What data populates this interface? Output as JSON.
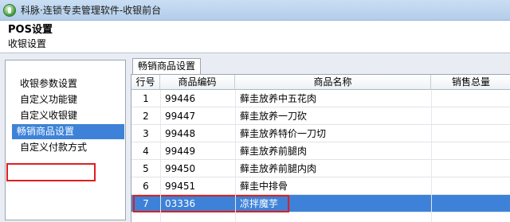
{
  "window": {
    "title": "科脉·连锁专卖管理软件-收银前台"
  },
  "header": {
    "title": "POS设置",
    "subtitle": "收银设置"
  },
  "sidebar": {
    "items": [
      {
        "label": "收银参数设置",
        "active": false
      },
      {
        "label": "自定义功能键",
        "active": false
      },
      {
        "label": "自定义收银键",
        "active": false
      },
      {
        "label": "畅销商品设置",
        "active": true
      },
      {
        "label": "自定义付款方式",
        "active": false
      }
    ]
  },
  "tab": {
    "label": "畅销商品设置"
  },
  "table": {
    "columns": [
      "行号",
      "商品编码",
      "商品名称",
      "销售总量"
    ],
    "rows": [
      {
        "no": "1",
        "code": "99446",
        "name": "藓圭放养中五花肉",
        "selected": false
      },
      {
        "no": "2",
        "code": "99447",
        "name": "藓圭放养一刀砍",
        "selected": false
      },
      {
        "no": "3",
        "code": "99448",
        "name": "藓圭放养特价一刀切",
        "selected": false
      },
      {
        "no": "4",
        "code": "99449",
        "name": "藓圭放养前腿肉",
        "selected": false
      },
      {
        "no": "5",
        "code": "99450",
        "name": "藓圭放养前腿内肉",
        "selected": false
      },
      {
        "no": "6",
        "code": "99451",
        "name": "藓圭中排骨",
        "selected": false
      },
      {
        "no": "7",
        "code": "03336",
        "name": "凉拌魔芋",
        "selected": true
      }
    ]
  },
  "colors": {
    "selection": "#3d82d8",
    "highlight_border": "#e01e1e"
  }
}
